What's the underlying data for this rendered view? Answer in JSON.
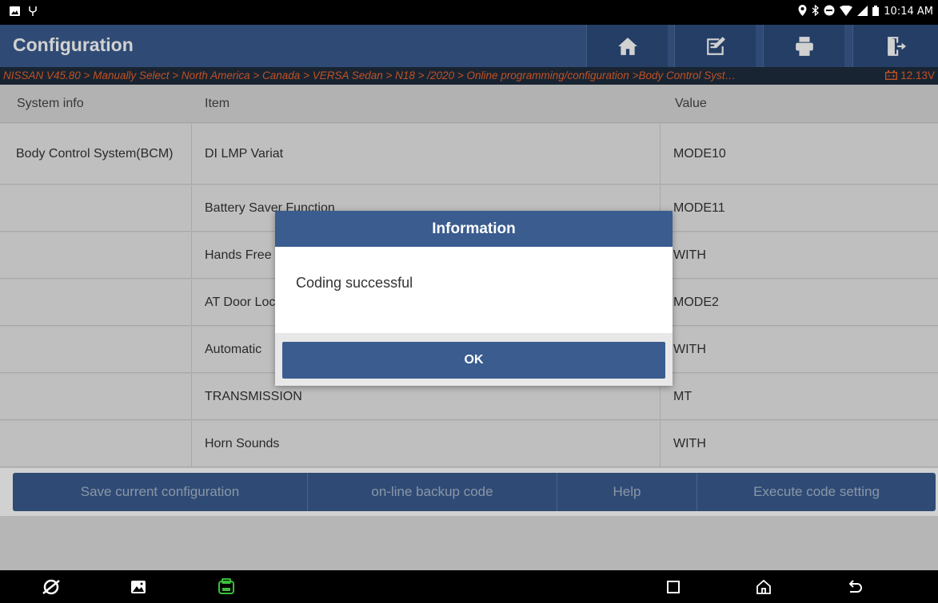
{
  "status_bar": {
    "time": "10:14 AM",
    "left_icons": [
      "image-notification-icon",
      "usb-debug-icon"
    ],
    "right_icons": [
      "location-icon",
      "bluetooth-icon",
      "dnd-icon",
      "wifi-icon",
      "signal-icon",
      "battery-icon"
    ]
  },
  "header": {
    "title": "Configuration",
    "buttons": [
      "home-icon",
      "edit-icon",
      "print-icon",
      "exit-icon"
    ]
  },
  "breadcrumb": {
    "path": "NISSAN V45.80 > Manually Select > North America > Canada > VERSA Sedan > N18 > /2020 > Online programming/configuration  >Body Control Syst…",
    "voltage": "12.13V"
  },
  "table": {
    "headers": [
      "System info",
      "Item",
      "Value"
    ],
    "rows": [
      {
        "system": "Body Control System(BCM)",
        "item": "DI LMP Variat",
        "value": "MODE10"
      },
      {
        "system": "",
        "item": "Battery Saver Function",
        "value": "MODE11"
      },
      {
        "system": "",
        "item": "Hands Free",
        "value": "WITH"
      },
      {
        "system": "",
        "item": "AT Door Lock",
        "value": "MODE2"
      },
      {
        "system": "",
        "item": "Automatic",
        "value": "WITH"
      },
      {
        "system": "",
        "item": "TRANSMISSION",
        "value": "MT"
      },
      {
        "system": "",
        "item": "Horn Sounds",
        "value": "WITH"
      }
    ]
  },
  "actions": {
    "save": "Save current configuration",
    "backup": "on-line backup code",
    "help": "Help",
    "execute": "Execute code setting"
  },
  "dialog": {
    "title": "Information",
    "message": "Coding successful",
    "ok": "OK"
  },
  "colors": {
    "primary": "#3a5c8f",
    "breadcrumb_text": "#e8632c",
    "vci_green": "#3bbf3b"
  }
}
